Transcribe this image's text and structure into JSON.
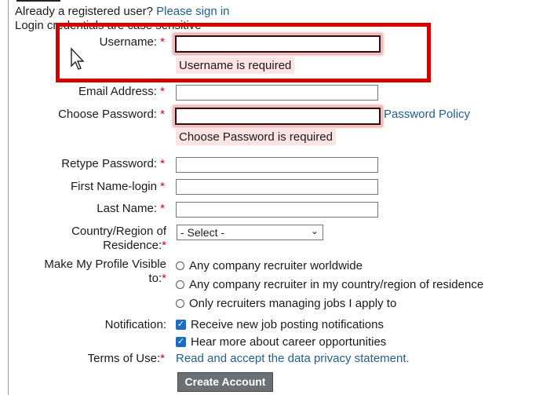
{
  "header": {
    "already_registered": "Already a registered user?",
    "sign_in_link": "Please sign in",
    "credentials_note": "Login credentials are case sensitive"
  },
  "form": {
    "required_marker": "*",
    "username": {
      "label": "Username:",
      "value": "",
      "error": "Username is required"
    },
    "email": {
      "label": "Email Address:",
      "value": ""
    },
    "password": {
      "label": "Choose Password:",
      "value": "",
      "policy_link": "Password Policy",
      "error": "Choose Password is required"
    },
    "retype_password": {
      "label": "Retype Password:",
      "value": ""
    },
    "first_name": {
      "label": "First Name-login",
      "value": ""
    },
    "last_name": {
      "label": "Last Name:",
      "value": ""
    },
    "country": {
      "label_line1": "Country/Region of",
      "label_line2": "Residence:",
      "selected": "- Select -"
    },
    "profile_visibility": {
      "label_line1": "Make My Profile Visible",
      "label_line2": "to:",
      "options": [
        "Any company recruiter worldwide",
        "Any company recruiter in my country/region of residence",
        "Only recruiters managing jobs I apply to"
      ]
    },
    "notification": {
      "label": "Notification:",
      "options": [
        "Receive new job posting notifications",
        "Hear more about career opportunities"
      ]
    },
    "terms": {
      "label": "Terms of Use:",
      "link": "Read and accept the data privacy statement."
    },
    "submit_label": "Create Account"
  },
  "colors": {
    "highlight": "#d40000",
    "link": "#1f5f8b",
    "error_bg": "#fde4e4",
    "checkbox": "#1c6cbf"
  }
}
